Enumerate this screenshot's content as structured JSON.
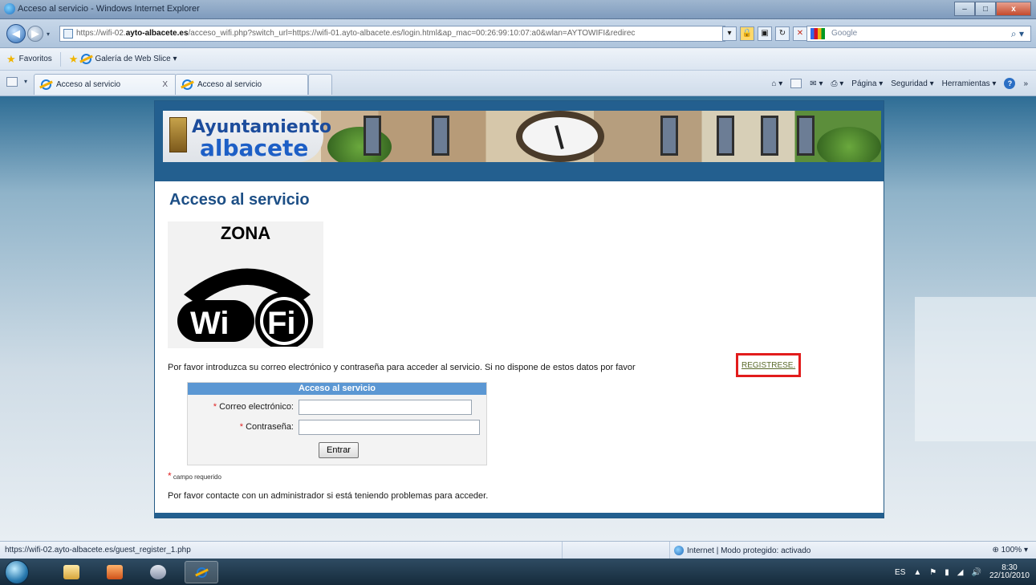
{
  "window": {
    "title": "Acceso al servicio - Windows Internet Explorer",
    "controls": {
      "minimize": "–",
      "maximize": "□",
      "close": "x"
    }
  },
  "address_bar": {
    "url_prefix": "https://wifi-02.",
    "url_domain": "ayto-albacete.es",
    "url_rest": "/acceso_wifi.php?switch_url=https://wifi-01.ayto-albacete.es/login.html&ap_mac=00:26:99:10:07:a0&wlan=AYTOWIFI&redirec",
    "search_placeholder": "Google",
    "search_icon": "magnifier-icon"
  },
  "favorites_bar": {
    "favorites_label": "Favoritos",
    "web_slice_label": "Galería de Web Slice ▾"
  },
  "tabs": [
    {
      "label": "Acceso al servicio",
      "close": "X"
    },
    {
      "label": "Acceso al servicio"
    }
  ],
  "command_bar": {
    "page": "Página ▾",
    "security": "Seguridad ▾",
    "tools": "Herramientas ▾",
    "help": "?",
    "more": "»"
  },
  "page": {
    "banner_logo_top": "Ayuntamiento",
    "banner_logo_bottom": "albacete",
    "title": "Acceso al servicio",
    "wifi_zona": "ZONA",
    "wifi_wi": "Wi",
    "wifi_fi": "Fi",
    "intro_text": "Por favor introduzca su correo electrónico y contraseña para acceder al servicio. Si no dispone de estos datos por favor",
    "register_link": "REGISTRESE.",
    "login_box": {
      "heading": "Acceso al servicio",
      "email_label": "Correo electrónico:",
      "email_value": "",
      "password_label": "Contraseña:",
      "password_value": "",
      "required_marker": "*",
      "submit_label": "Entrar"
    },
    "required_note": "campo requerido",
    "contact_text": "Por favor contacte con un administrador si está teniendo problemas para acceder."
  },
  "status_bar": {
    "hover_url": "https://wifi-02.ayto-albacete.es/guest_register_1.php",
    "zone_text": "Internet | Modo protegido: activado",
    "zoom": "100%"
  },
  "taskbar": {
    "language": "ES",
    "time": "8:30",
    "date": "22/10/2010"
  },
  "colors": {
    "accent": "#235f8f",
    "login_header": "#5b97d3",
    "highlight_box": "#e21c1c",
    "title_text": "#1d4f86"
  }
}
